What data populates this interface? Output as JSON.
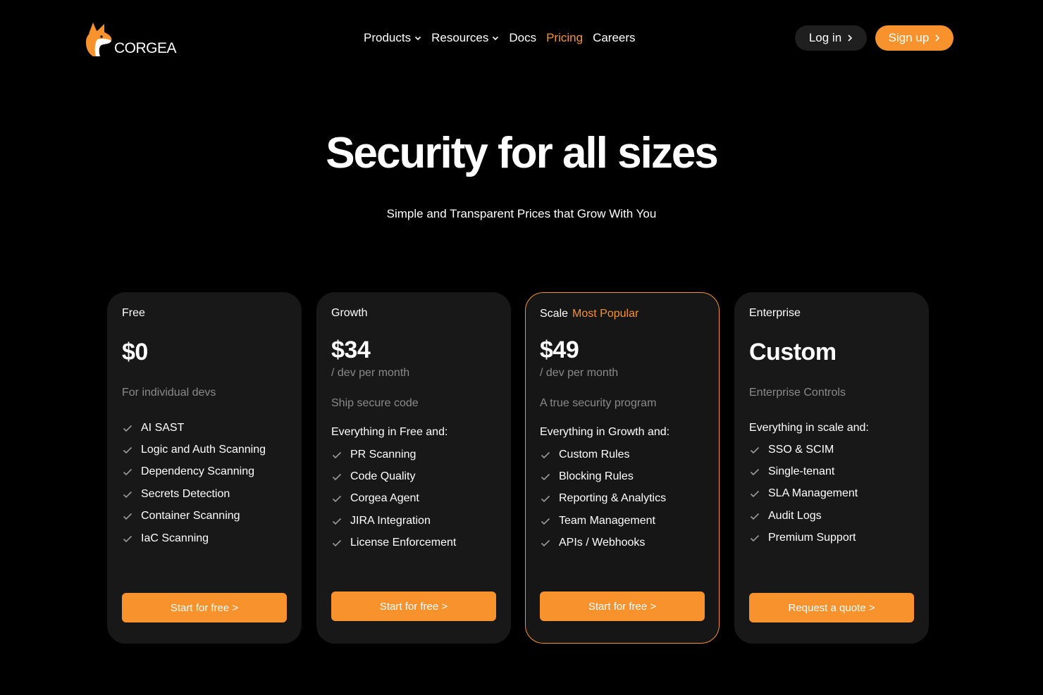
{
  "brand": {
    "name": "CORGEA"
  },
  "nav": {
    "items": [
      {
        "label": "Products",
        "has_dropdown": true,
        "active": false
      },
      {
        "label": "Resources",
        "has_dropdown": true,
        "active": false
      },
      {
        "label": "Docs",
        "has_dropdown": false,
        "active": false
      },
      {
        "label": "Pricing",
        "has_dropdown": false,
        "active": true
      },
      {
        "label": "Careers",
        "has_dropdown": false,
        "active": false
      }
    ],
    "login_label": "Log in",
    "signup_label": "Sign up"
  },
  "hero": {
    "title": "Security for all sizes",
    "subtitle": "Simple and Transparent Prices that Grow With You"
  },
  "plans": [
    {
      "name": "Free",
      "badge": "",
      "price": "$0",
      "price_unit": "",
      "tagline": "For individual devs",
      "features_header": "",
      "features": [
        "AI SAST",
        "Logic and Auth Scanning",
        "Dependency Scanning",
        "Secrets Detection",
        "Container Scanning",
        "IaC Scanning"
      ],
      "cta": "Start for free >"
    },
    {
      "name": "Growth",
      "badge": "",
      "price": "$34",
      "price_unit": "/ dev per month",
      "tagline": "Ship secure code",
      "features_header": "Everything in Free and:",
      "features": [
        "PR Scanning",
        "Code Quality",
        "Corgea Agent",
        "JIRA  Integration",
        "License Enforcement"
      ],
      "cta": "Start for free >"
    },
    {
      "name": "Scale",
      "badge": "Most Popular",
      "price": "$49",
      "price_unit": "/ dev per month",
      "tagline": "A true security program",
      "features_header": "Everything in Growth and:",
      "features": [
        "Custom Rules",
        "Blocking Rules",
        "Reporting & Analytics",
        "Team Management",
        "APIs / Webhooks"
      ],
      "cta": "Start for free >"
    },
    {
      "name": "Enterprise",
      "badge": "",
      "price": "Custom",
      "price_unit": "",
      "tagline": "Enterprise Controls",
      "features_header": "Everything in scale and:",
      "features": [
        "SSO & SCIM",
        "Single-tenant",
        "SLA Management",
        "Audit Logs",
        "Premium Support"
      ],
      "cta": "Request a quote >"
    }
  ],
  "colors": {
    "accent": "#f7922d",
    "background": "#000000",
    "card": "#181818",
    "muted": "#8a8a8a"
  }
}
